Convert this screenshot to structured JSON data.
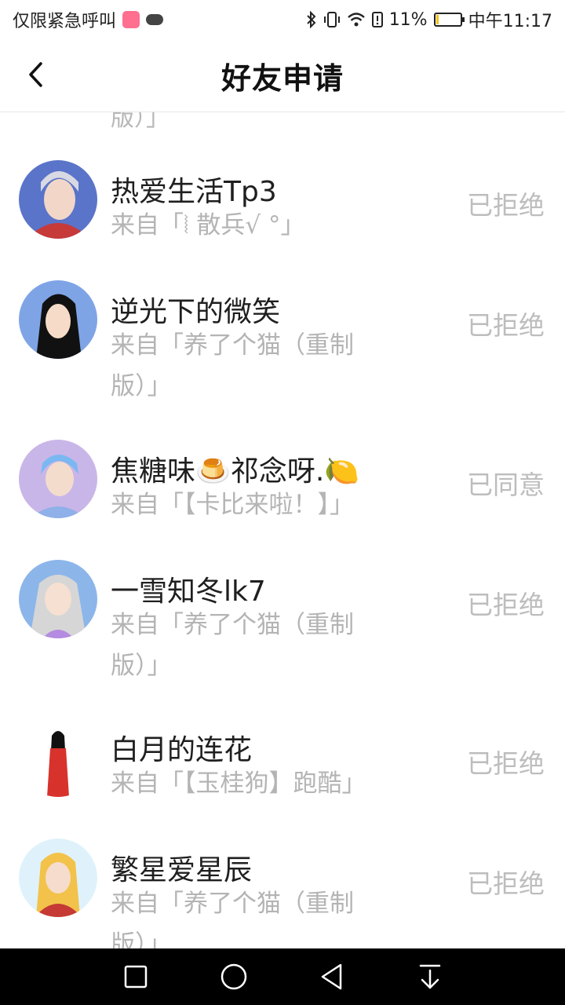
{
  "status_bar": {
    "left_text": "仅限紧急呼叫",
    "battery": "11%",
    "time": "中午11:17"
  },
  "header": {
    "title": "好友申请"
  },
  "list": {
    "partial_top_text": "版）」",
    "items": [
      {
        "name": "热爱生活Tp3",
        "source": "来自「⦚ 散兵√ °」",
        "status": "已拒绝"
      },
      {
        "name": "逆光下的微笑",
        "source": "来自「养了个猫（重制版）」",
        "status": "已拒绝"
      },
      {
        "name": "焦糖味🍮祁念呀.🍋",
        "source": "来自「【卡比来啦！】」",
        "status": "已同意"
      },
      {
        "name": "一雪知冬lk7",
        "source": "来自「养了个猫（重制版）」",
        "status": "已拒绝"
      },
      {
        "name": "白月的连花",
        "source": "来自「【玉桂狗】跑酷」",
        "status": "已拒绝"
      },
      {
        "name": "繁星爱星辰",
        "source": "来自「养了个猫（重制版）」",
        "status": "已拒绝"
      }
    ]
  },
  "colors": {
    "accent_text": "#1f1f1f",
    "muted_text": "#b4b4b4",
    "status_text": "#bdbdbd",
    "nav_bg": "#000000"
  },
  "icons": {
    "back": "chevron-left-icon",
    "nav": [
      "square-recent-icon",
      "circle-home-icon",
      "triangle-back-icon",
      "download-arrow-icon"
    ]
  }
}
